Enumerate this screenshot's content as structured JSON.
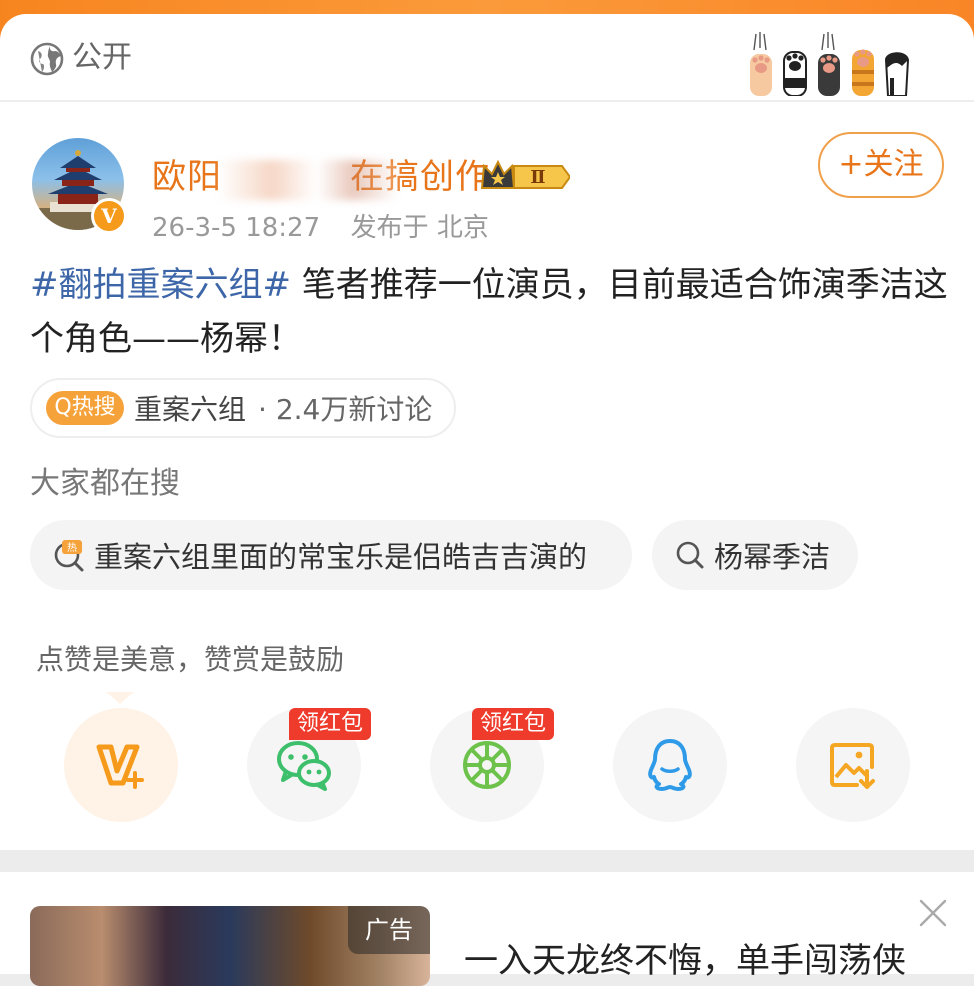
{
  "visibility": {
    "icon": "globe-icon",
    "label": "公开"
  },
  "author": {
    "name": "欧阳",
    "name_tail": "在搞创作",
    "verified_badge": "V",
    "vip_level": "Ⅱ",
    "post_time": "26-3-5 18:27",
    "location": "发布于 北京"
  },
  "follow_button": {
    "label": "+关注"
  },
  "post": {
    "hashtag": "#翻拍重案六组#",
    "text": " 笔者推荐一位演员，目前最适合饰演季洁这个角色——杨幂！"
  },
  "hot_search": {
    "badge": "Q热搜",
    "topic": "重案六组",
    "count": "· 2.4万新讨论"
  },
  "people_searching": {
    "heading": "大家都在搜",
    "items": [
      {
        "icon": "hot-search-icon",
        "text": "重案六组里面的常宝乐是侣皓吉吉演的"
      },
      {
        "icon": "search-icon",
        "text": "杨幂季洁"
      }
    ]
  },
  "tip": {
    "text": "点赞是美意，赞赏是鼓励"
  },
  "share_actions": [
    {
      "icon": "reward-icon",
      "color": "#f59a1b"
    },
    {
      "icon": "wechat-icon",
      "color": "#3dbf6b",
      "tag": "领红包"
    },
    {
      "icon": "moments-icon",
      "color": "#6dc24b",
      "tag": "领红包"
    },
    {
      "icon": "qq-icon",
      "color": "#2f9be8"
    },
    {
      "icon": "save-image-icon",
      "color": "#f5a623"
    }
  ],
  "ad": {
    "label": "广告",
    "title": "一入天龙终不悔，单手闯荡侠"
  },
  "colors": {
    "accent": "#e8751a",
    "hashtag": "#3d66a8",
    "hot_badge": "#f6a23b",
    "red_tag": "#ee3b2c"
  }
}
